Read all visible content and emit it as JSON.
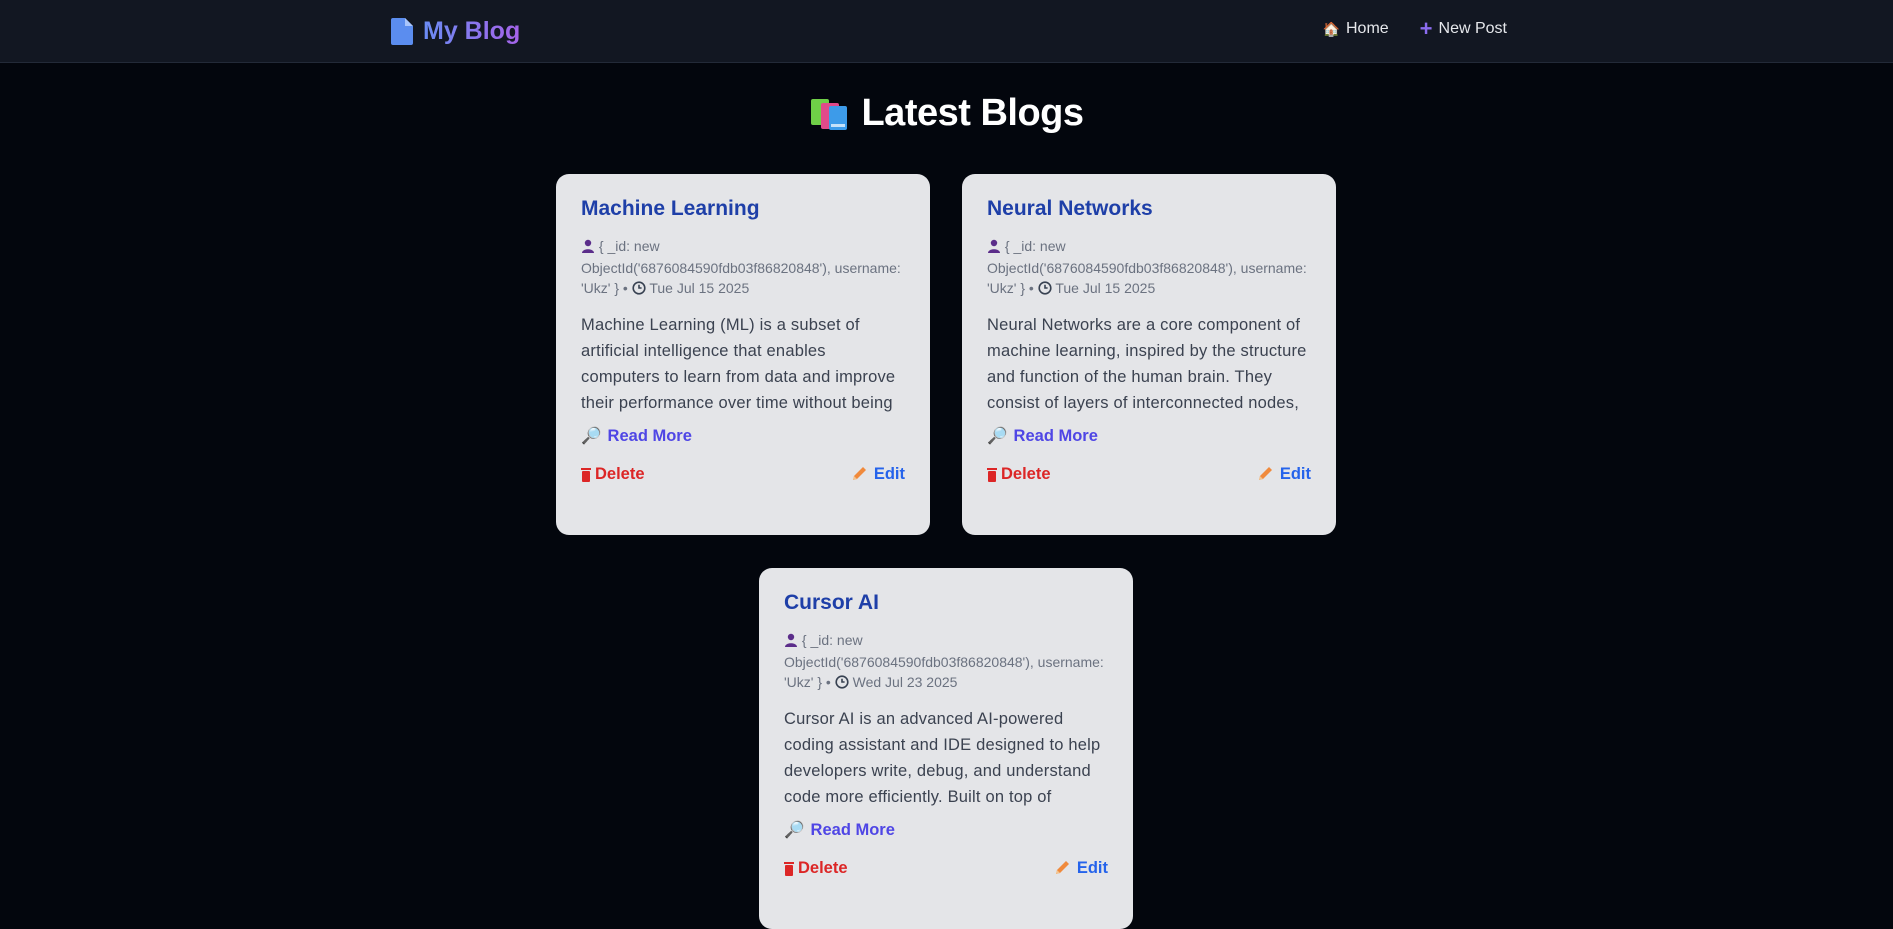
{
  "app": {
    "brand": "My Blog",
    "nav": [
      {
        "icon": "house-icon",
        "label": "Home"
      },
      {
        "icon": "plus-icon",
        "label": "New Post"
      }
    ]
  },
  "page": {
    "heading": "Latest Blogs",
    "heading_icon": "books-icon"
  },
  "posts": [
    {
      "title": "Machine Learning",
      "author": "{ _id: new ObjectId('6876084590fdb03f86820848'), username: 'Ukz' }",
      "date": "Tue Jul 15 2025",
      "excerpt": "Machine Learning (ML) is a subset of artificial intelligence that enables computers to learn from data and improve their performance over time without being explicitly programmed.",
      "read_more": "Read More",
      "delete": "Delete",
      "edit": "Edit"
    },
    {
      "title": "Neural Networks",
      "author": "{ _id: new ObjectId('6876084590fdb03f86820848'), username: 'Ukz' }",
      "date": "Tue Jul 15 2025",
      "excerpt": "Neural Networks are a core component of machine learning, inspired by the structure and function of the human brain. They consist of layers of interconnected nodes, or \"neurons,\" that",
      "read_more": "Read More",
      "delete": "Delete",
      "edit": "Edit"
    },
    {
      "title": "Cursor AI",
      "author": "{ _id: new ObjectId('6876084590fdb03f86820848'), username: 'Ukz' }",
      "date": "Wed Jul 23 2025",
      "excerpt": "Cursor AI is an advanced AI-powered coding assistant and IDE designed to help developers write, debug, and understand code more efficiently. Built on top of powerful language models like",
      "read_more": "Read More",
      "delete": "Delete",
      "edit": "Edit"
    }
  ],
  "colors": {
    "background": "#03060d",
    "navbar": "#121722",
    "card": "#e4e5e8",
    "title": "#1e3fa8",
    "read_more": "#4f46e5",
    "delete": "#dc2626",
    "edit": "#2563eb"
  }
}
